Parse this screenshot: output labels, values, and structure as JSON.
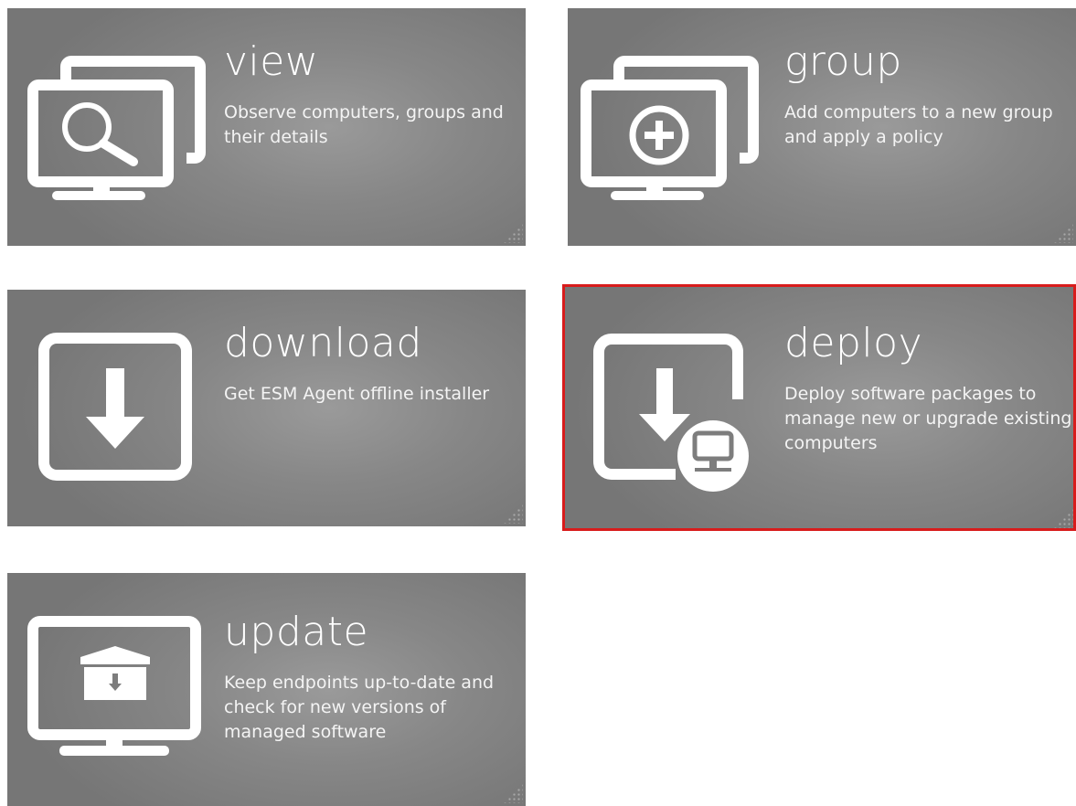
{
  "tiles": {
    "view": {
      "title": "view",
      "description": "Observe computers, groups and their details",
      "icon": "monitor-search-icon"
    },
    "group": {
      "title": "group",
      "description": "Add computers to a new group and apply a policy",
      "icon": "monitor-add-icon"
    },
    "download": {
      "title": "download",
      "description": "Get ESM Agent offline installer",
      "icon": "download-arrow-icon"
    },
    "deploy": {
      "title": "deploy",
      "description": "Deploy software packages to manage new or upgrade existing computers",
      "icon": "deploy-computer-icon",
      "selected": true
    },
    "update": {
      "title": "update",
      "description": "Keep endpoints up-to-date and check for new versions of managed software",
      "icon": "monitor-package-icon"
    }
  },
  "colors": {
    "tile_background": "#878787",
    "tile_text": "#ffffff",
    "selected_border": "#d81c1c"
  }
}
